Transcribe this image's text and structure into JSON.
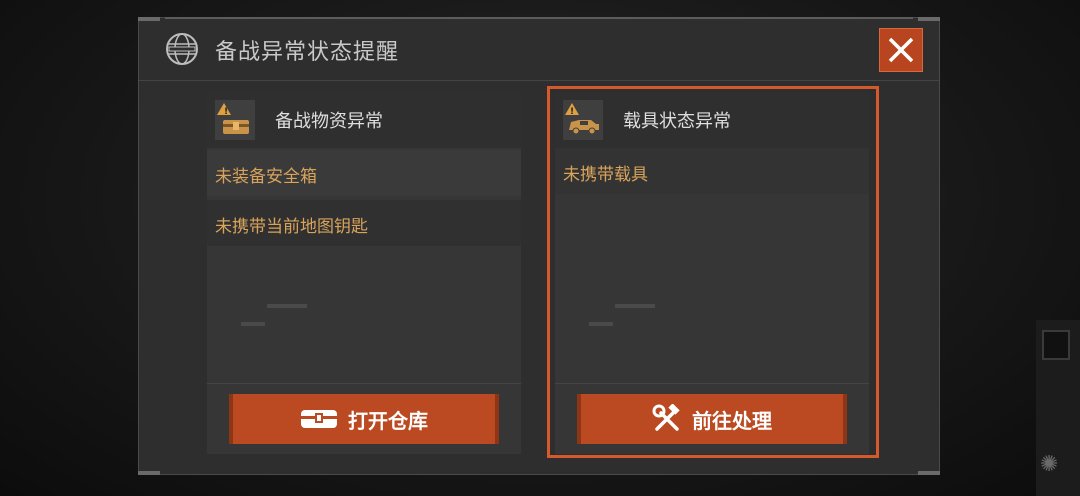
{
  "dialog": {
    "title": "备战异常状态提醒"
  },
  "panels": [
    {
      "title": "备战物资异常",
      "items": [
        "未装备安全箱",
        "未携带当前地图钥匙"
      ],
      "button_label": "打开仓库",
      "button_icon": "chest-icon",
      "header_icon": "supply-crate-icon"
    },
    {
      "title": "载具状态异常",
      "items": [
        "未携带载具"
      ],
      "button_label": "前往处理",
      "button_icon": "wrench-hammer-icon",
      "header_icon": "vehicle-icon",
      "highlighted": true
    }
  ],
  "colors": {
    "accent": "#bb4a22",
    "warning_text": "#d8a35b",
    "highlight_border": "#d6582d"
  }
}
